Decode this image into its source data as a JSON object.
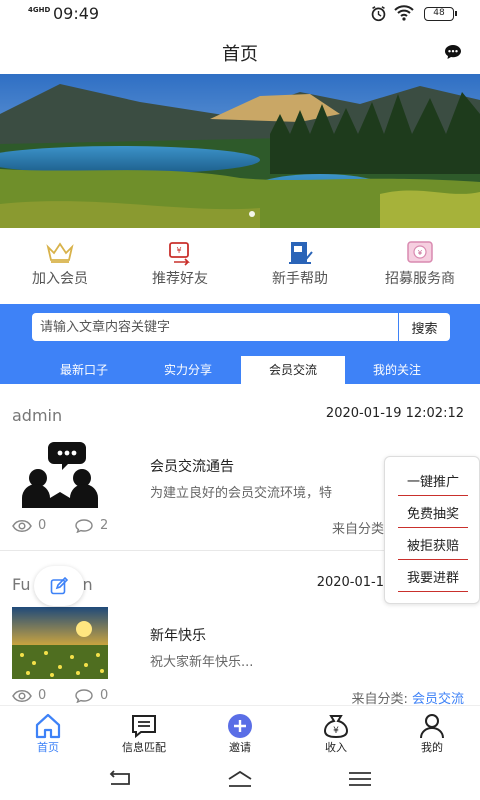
{
  "status": {
    "network": "4GHD",
    "time": "09:49",
    "battery": "48"
  },
  "header": {
    "title": "首页"
  },
  "quick_links": [
    {
      "label": "加入会员",
      "icon": "crown-icon"
    },
    {
      "label": "推荐好友",
      "icon": "share-icon"
    },
    {
      "label": "新手帮助",
      "icon": "help-book-icon"
    },
    {
      "label": "招募服务商",
      "icon": "recruit-icon"
    }
  ],
  "search": {
    "placeholder": "请输入文章内容关键字",
    "button": "搜索"
  },
  "tabs": [
    {
      "label": "最新口子",
      "active": false
    },
    {
      "label": "实力分享",
      "active": false
    },
    {
      "label": "会员交流",
      "active": true
    },
    {
      "label": "我的关注",
      "active": false
    }
  ],
  "posts": [
    {
      "author": "admin",
      "date": "2020-01-19 12:02:12",
      "title": "会员交流通告",
      "excerpt": "为建立良好的会员交流环境，特",
      "views": "0",
      "comments": "2",
      "category_prefix": "来自分类",
      "category": ""
    },
    {
      "author": "Fu",
      "author_end": "n",
      "date": "2020-01-1",
      "title": "新年快乐",
      "excerpt": "祝大家新年快乐...",
      "views": "0",
      "comments": "0",
      "category_prefix": "来自分类: ",
      "category": "会员交流"
    }
  ],
  "popup_menu": [
    "一键推广",
    "免费抽奖",
    "被拒获赔",
    "我要进群"
  ],
  "bottom_nav": [
    {
      "label": "首页",
      "icon": "home-icon",
      "active": true
    },
    {
      "label": "信息匹配",
      "icon": "message-icon",
      "active": false
    },
    {
      "label": "邀请",
      "icon": "plus-circle-icon",
      "active": false
    },
    {
      "label": "收入",
      "icon": "money-bag-icon",
      "active": false
    },
    {
      "label": "我的",
      "icon": "user-icon",
      "active": false
    }
  ],
  "colors": {
    "accent": "#3e82f7",
    "popup_underline": "#c9302c"
  }
}
